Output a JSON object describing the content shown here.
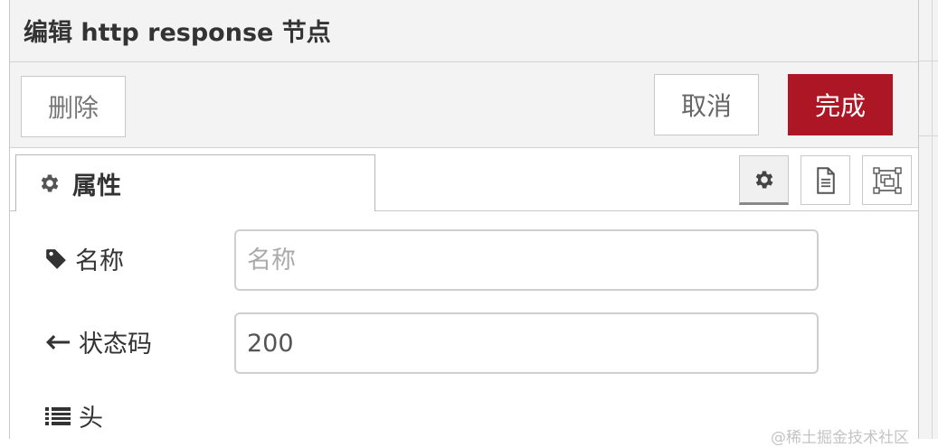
{
  "dialog": {
    "title": "编辑 http response 节点"
  },
  "toolbar": {
    "delete_label": "删除",
    "cancel_label": "取消",
    "done_label": "完成"
  },
  "tabs": {
    "properties_label": "属性"
  },
  "form": {
    "name": {
      "label": "名称",
      "placeholder": "名称",
      "value": ""
    },
    "status_code": {
      "label": "状态码",
      "value": "200"
    },
    "headers": {
      "label": "头"
    }
  },
  "watermark": "@稀土掘金技术社区",
  "colors": {
    "done_button": "#ad1625",
    "header_background": "#f3f3f3"
  },
  "icons": {
    "tab": "cog-icon",
    "name": "tag-icon",
    "status": "arrow-left-icon",
    "headers": "list-icon",
    "tray_buttons": [
      "cog-icon",
      "file-text-icon",
      "object-group-icon"
    ]
  }
}
